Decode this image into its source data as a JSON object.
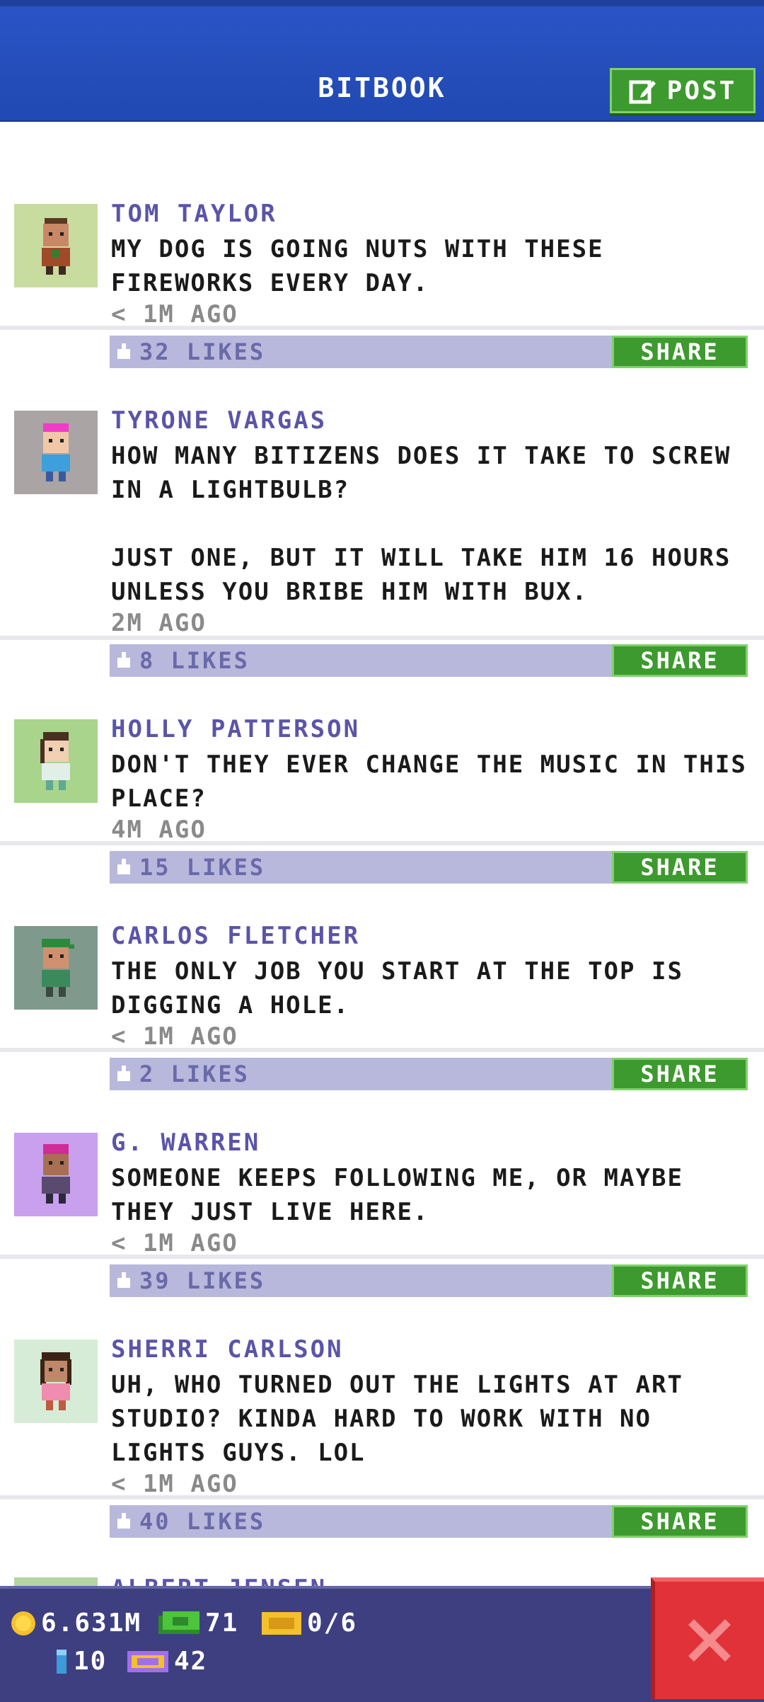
{
  "header": {
    "title": "BITBOOK",
    "post_label": "POST"
  },
  "feed": [
    {
      "author": "TOM TAYLOR",
      "text": "MY DOG IS GOING NUTS WITH THESE FIREWORKS EVERY DAY.",
      "time": "< 1M AGO",
      "likes": "32 LIKES",
      "share_label": "SHARE",
      "avatar_bg": "#c8dca0"
    },
    {
      "author": "TYRONE VARGAS",
      "text": "HOW MANY BITIZENS DOES IT TAKE TO SCREW IN A LIGHTBULB?\n\nJUST ONE, BUT IT WILL TAKE HIM 16 HOURS UNLESS YOU BRIBE HIM WITH BUX.",
      "time": "2M AGO",
      "likes": "8 LIKES",
      "share_label": "SHARE",
      "avatar_bg": "#aaa4a4"
    },
    {
      "author": "HOLLY PATTERSON",
      "text": "DON'T THEY EVER CHANGE THE MUSIC IN THIS PLACE?",
      "time": "4M AGO",
      "likes": "15 LIKES",
      "share_label": "SHARE",
      "avatar_bg": "#a8d48c"
    },
    {
      "author": "CARLOS FLETCHER",
      "text": "THE ONLY JOB YOU START AT THE TOP IS DIGGING A HOLE.",
      "time": "< 1M AGO",
      "likes": "2 LIKES",
      "share_label": "SHARE",
      "avatar_bg": "#7f9a8c"
    },
    {
      "author": "G. WARREN",
      "text": "SOMEONE KEEPS FOLLOWING ME, OR MAYBE THEY JUST LIVE HERE.",
      "time": "< 1M AGO",
      "likes": "39 LIKES",
      "share_label": "SHARE",
      "avatar_bg": "#c8a0ee"
    },
    {
      "author": "SHERRI CARLSON",
      "text": "UH, WHO TURNED OUT THE LIGHTS AT ART STUDIO? KINDA HARD TO WORK WITH NO LIGHTS GUYS. LOL",
      "time": "< 1M AGO",
      "likes": "40 LIKES",
      "share_label": "SHARE",
      "avatar_bg": "#d6ecd6"
    }
  ],
  "peek_author": "ALBERT JENSEN",
  "status": {
    "coins": "6.631M",
    "bux": "71",
    "tickets": "0/6",
    "bitizens": "10",
    "vip": "42"
  }
}
